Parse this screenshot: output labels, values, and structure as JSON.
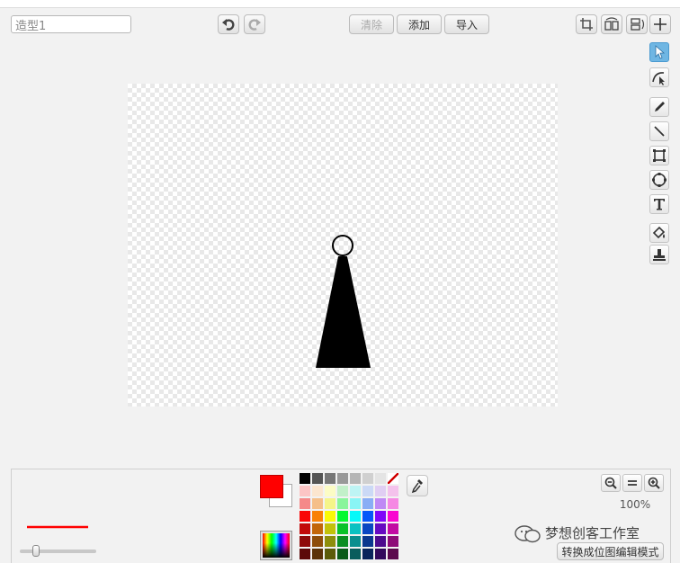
{
  "header": {
    "costume_name": "造型1"
  },
  "toolbar": {
    "clear_label": "清除",
    "add_label": "添加",
    "import_label": "导入"
  },
  "tools": [
    "select-icon",
    "reshape-icon",
    "pencil-icon",
    "line-icon",
    "rectangle-icon",
    "ellipse-icon",
    "text-icon",
    "fill-icon",
    "stamp-icon"
  ],
  "colors": {
    "primary": "#ff0000",
    "secondary": "#ffffff",
    "active_tool": "#6fb6e3",
    "drawing": "#000000"
  },
  "zoom": {
    "level": "100%"
  },
  "footer": {
    "watermark_text": "梦想创客工作室",
    "convert_label": "转换成位图编辑模式"
  }
}
